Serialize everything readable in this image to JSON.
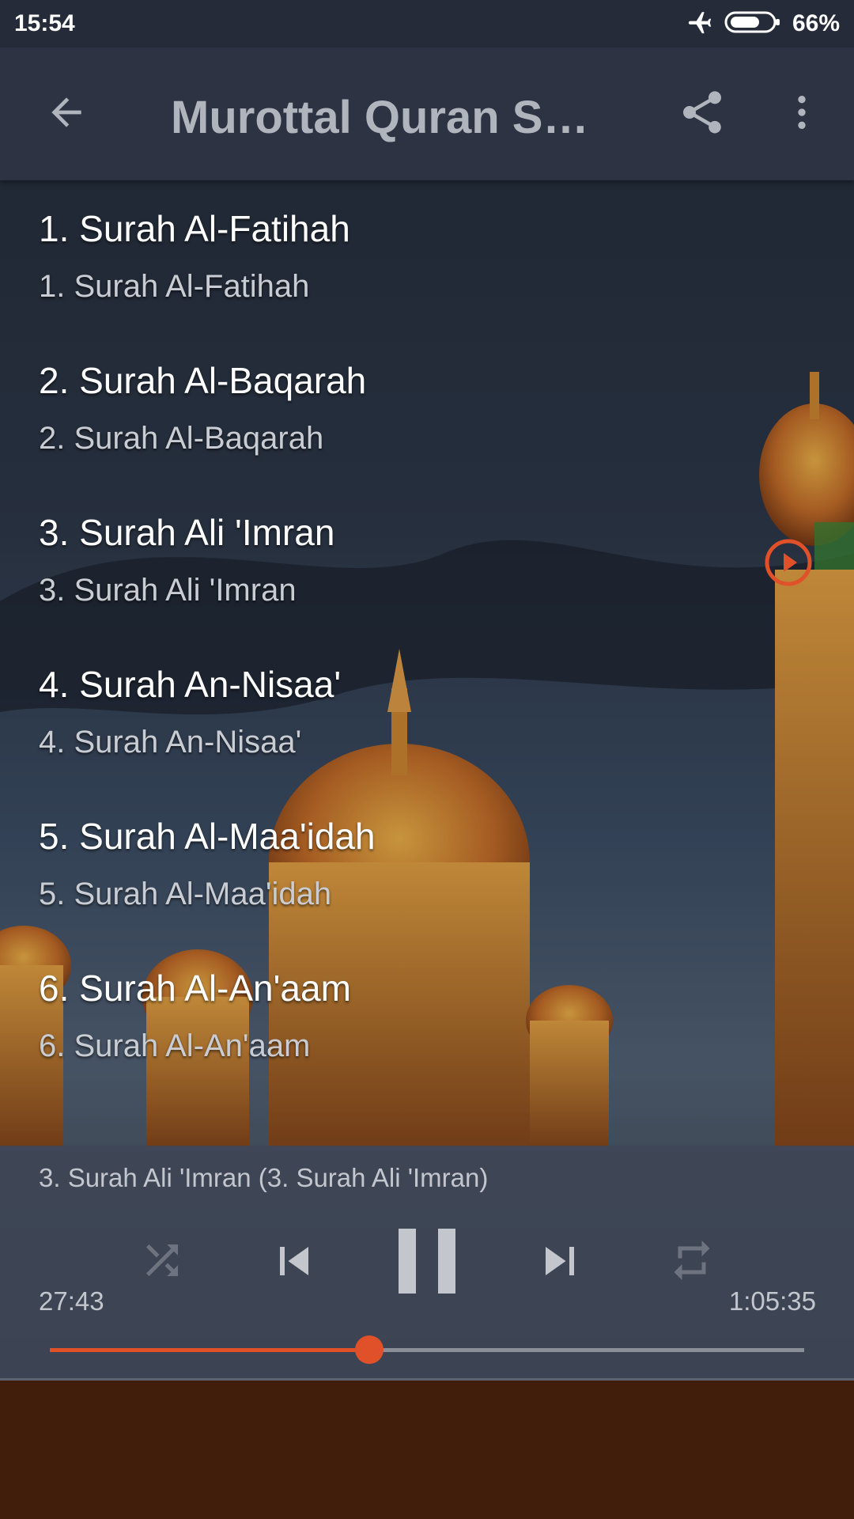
{
  "status_bar": {
    "time": "15:54",
    "battery_percent": "66%",
    "icons": [
      "airplane-mode-icon",
      "battery-icon"
    ]
  },
  "app_bar": {
    "title": "Murottal Quran Saa...",
    "icons": [
      "back-arrow-icon",
      "share-icon",
      "more-vert-icon"
    ]
  },
  "tracks": [
    {
      "title": "1. Surah Al-Fatihah",
      "subtitle": "1. Surah Al-Fatihah"
    },
    {
      "title": "2. Surah Al-Baqarah",
      "subtitle": "2. Surah Al-Baqarah"
    },
    {
      "title": "3. Surah Ali 'Imran",
      "subtitle": "3. Surah Ali 'Imran"
    },
    {
      "title": "4. Surah An-Nisaa'",
      "subtitle": "4. Surah An-Nisaa'"
    },
    {
      "title": "5. Surah Al-Maa'idah",
      "subtitle": "5. Surah Al-Maa'idah"
    },
    {
      "title": "6. Surah Al-An'aam",
      "subtitle": "6. Surah Al-An'aam"
    }
  ],
  "playing_index": 2,
  "player": {
    "now_playing": "3. Surah Ali 'Imran (3. Surah Ali 'Imran)",
    "elapsed": "27:43",
    "total": "1:05:35",
    "progress_fraction": 0.423,
    "controls": [
      "shuffle-icon",
      "skip-previous-icon",
      "pause-icon",
      "skip-next-icon",
      "repeat-icon"
    ]
  },
  "colors": {
    "accent": "#e0512a",
    "app_bar": "#2d3342",
    "status_bar": "#252b39"
  }
}
